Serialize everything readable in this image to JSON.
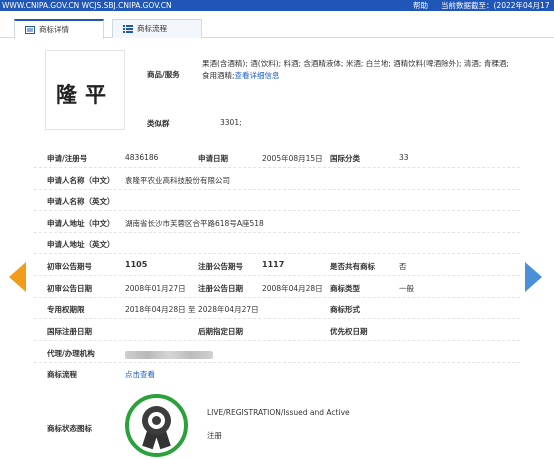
{
  "topbar": {
    "url": "WWW.CNIPA.GOV.CN WCJS.SBJ.CNIPA.GOV.CN",
    "help": "帮助",
    "date": "当前数据截至：(2022年04月17日)",
    "bg": "#1f56b8"
  },
  "tabs": [
    {
      "label": "商标详情",
      "icon": "document-icon",
      "active": true
    },
    {
      "label": "商标流程",
      "icon": "list-icon",
      "active": false
    }
  ],
  "logo_text": "隆平",
  "goods": {
    "label": "商品/服务",
    "text": "果酒(含酒精); 酒(饮料); 料酒; 含酒精液体; 米酒; 白兰地; 酒精饮料(啤酒除外); 清酒; 青稞酒; 食用酒精;",
    "link": "查看详细信息"
  },
  "similar_group": {
    "label": "类似群",
    "value": "3301;"
  },
  "rows": {
    "reg_no": {
      "label": "申请/注册号",
      "value": "4836186"
    },
    "app_date": {
      "label": "申请日期",
      "value": "2005年08月15日"
    },
    "intl_class": {
      "label": "国际分类",
      "value": "33"
    },
    "applicant_cn": {
      "label": "申请人名称（中文）",
      "value": "袁隆平农业高科技股份有限公司"
    },
    "applicant_en": {
      "label": "申请人名称（英文）",
      "value": ""
    },
    "address_cn": {
      "label": "申请人地址（中文）",
      "value": "湖南省长沙市芙蓉区合平路618号A座518"
    },
    "address_en": {
      "label": "申请人地址（英文）",
      "value": ""
    },
    "prelim_pub_no": {
      "label": "初审公告期号",
      "value": "1105"
    },
    "reg_pub_no": {
      "label": "注册公告期号",
      "value": "1117"
    },
    "shared": {
      "label": "是否共有商标",
      "value": "否"
    },
    "prelim_pub_date": {
      "label": "初审公告日期",
      "value": "2008年01月27日"
    },
    "reg_pub_date": {
      "label": "注册公告日期",
      "value": "2008年04月28日"
    },
    "tm_type": {
      "label": "商标类型",
      "value": "一般"
    },
    "exclusive_period": {
      "label": "专用权期限",
      "value": "2018年04月28日 至 2028年04月27日"
    },
    "tm_form": {
      "label": "商标形式",
      "value": ""
    },
    "intl_reg_date": {
      "label": "国际注册日期",
      "value": ""
    },
    "later_designation": {
      "label": "后期指定日期",
      "value": ""
    },
    "priority_date": {
      "label": "优先权日期",
      "value": ""
    },
    "agent": {
      "label": "代理/办理机构",
      "value": ""
    },
    "process": {
      "label": "商标流程",
      "link": "点击查看"
    }
  },
  "status": {
    "label": "商标状态图标",
    "en": "LIVE/REGISTRATION/Issued and Active",
    "cn": "注册",
    "seal_color": "#2aa13a"
  },
  "nav": {
    "prev_color": "#f39b1a",
    "next_color": "#4a90d9"
  }
}
